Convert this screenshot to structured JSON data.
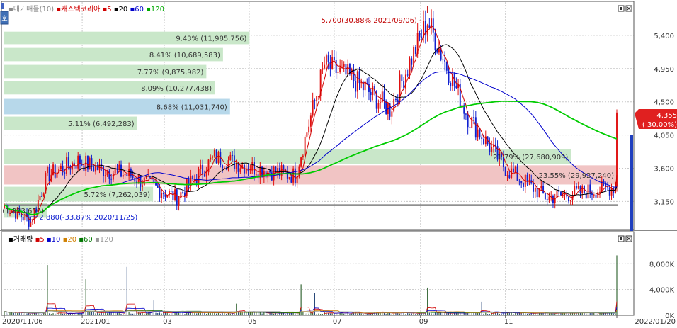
{
  "header": {
    "price_legend": [
      {
        "text": "매기매물(10)",
        "color": "#888888"
      },
      {
        "text": "캐스텍코리아",
        "color": "#d00000"
      },
      {
        "text": "5",
        "color": "#d00000"
      },
      {
        "text": "20",
        "color": "#000000"
      },
      {
        "text": "60",
        "color": "#0000cc"
      },
      {
        "text": "120",
        "color": "#00aa00"
      }
    ],
    "volume_legend": [
      {
        "text": "거래량",
        "color": "#000000"
      },
      {
        "text": "5",
        "color": "#d00000"
      },
      {
        "text": "10",
        "color": "#0000cc"
      },
      {
        "text": "20",
        "color": "#d08000"
      },
      {
        "text": "60",
        "color": "#007700"
      },
      {
        "text": "120",
        "color": "#999999"
      }
    ],
    "side_button": "호"
  },
  "chart_data": [
    {
      "type": "candlestick",
      "title": "캐스텍코리아",
      "x_start": "2020/11/06",
      "x_end": "2022/01/20",
      "x_labels": [
        "2020/11/06",
        "2021/01",
        "03",
        "05",
        "07",
        "09",
        "11",
        "2022/01/20"
      ],
      "y_ticks": [
        3150,
        3600,
        4050,
        4500,
        4950,
        5400
      ],
      "y_tick_labels": [
        "3,150",
        "3,600",
        "4,050",
        "4,500",
        "4,950",
        "5,400"
      ],
      "ylim": [
        2780,
        5850
      ],
      "anchors": [
        {
          "x": "2020/11/06",
          "close": 3100
        },
        {
          "x": "2020/11/25",
          "close": 2880
        },
        {
          "x": "2020/12/07",
          "close": 3500
        },
        {
          "x": "2020/12/29",
          "close": 3700
        },
        {
          "x": "2021/01/12",
          "close": 3600
        },
        {
          "x": "2021/02/05",
          "close": 3500
        },
        {
          "x": "2021/03/10",
          "close": 3200
        },
        {
          "x": "2021/04/06",
          "close": 3750
        },
        {
          "x": "2021/05/06",
          "close": 3600
        },
        {
          "x": "2021/06/03",
          "close": 3500
        },
        {
          "x": "2021/06/24",
          "close": 5000
        },
        {
          "x": "2021/07/15",
          "close": 4800
        },
        {
          "x": "2021/08/10",
          "close": 4400
        },
        {
          "x": "2021/09/06",
          "close": 5600
        },
        {
          "x": "2021/10/05",
          "close": 4300
        },
        {
          "x": "2021/11/01",
          "close": 3600
        },
        {
          "x": "2021/12/01",
          "close": 3200
        },
        {
          "x": "2022/01/19",
          "close": 3350
        },
        {
          "x": "2022/01/20",
          "close": 4355
        }
      ],
      "annotations": {
        "high": "5,700(30.88% 2021/09/06)",
        "low": "2,880(-33.87% 2020/11/25)"
      },
      "volume_profile": [
        {
          "label": "9.43% (11,985,756)",
          "low": 5280,
          "high": 5450,
          "color": "#c9e7c9"
        },
        {
          "label": "8.41% (10,689,583)",
          "low": 5050,
          "high": 5230,
          "color": "#c9e7c9"
        },
        {
          "label": "7.77% (9,875,982)",
          "low": 4820,
          "high": 5000,
          "color": "#c9e7c9"
        },
        {
          "label": "8.09% (10,277,438)",
          "low": 4600,
          "high": 4780,
          "color": "#c9e7c9"
        },
        {
          "label": "8.68% (11,031,740)",
          "low": 4330,
          "high": 4540,
          "color": "#b7d8ea"
        },
        {
          "label": "5.11% (6,492,283)",
          "low": 4120,
          "high": 4300,
          "color": "#c9e7c9"
        },
        {
          "label": "21.79% (27,680,909)",
          "low": 3660,
          "high": 3860,
          "color": "#c9e7c9"
        },
        {
          "label": "23.55% (29,927,240)",
          "low": 3380,
          "high": 3640,
          "color": "#f1c4c4"
        },
        {
          "label": "5.72% (7,262,039)",
          "low": 3150,
          "high": 3350,
          "color": "#c9e7c9"
        },
        {
          "label": "1.4% (1,823,656)",
          "low": 2930,
          "high": 3130,
          "color": "#c9e7c9"
        }
      ],
      "moving_averages": [
        5,
        20,
        60,
        120
      ],
      "last_price": "4,355",
      "last_change": "( 30.00%)",
      "support_line": 3100
    },
    {
      "type": "bar",
      "title": "거래량",
      "y_tick_labels": [
        "8,000K",
        "4,000K",
        "0K"
      ],
      "y_ticks": [
        8000,
        4000,
        0
      ],
      "ylim": [
        0,
        11000
      ],
      "spikes": [
        {
          "x": "2020/11/06",
          "value": 600
        },
        {
          "x": "2020/12/07",
          "value": 7800
        },
        {
          "x": "2021/01/04",
          "value": 5600
        },
        {
          "x": "2021/02/02",
          "value": 7500
        },
        {
          "x": "2021/02/22",
          "value": 2300
        },
        {
          "x": "2021/04/22",
          "value": 1800
        },
        {
          "x": "2021/06/07",
          "value": 4800
        },
        {
          "x": "2021/06/17",
          "value": 3500
        },
        {
          "x": "2021/09/06",
          "value": 4300
        },
        {
          "x": "2021/10/15",
          "value": 2100
        },
        {
          "x": "2022/01/20",
          "value": 9300
        }
      ]
    }
  ]
}
